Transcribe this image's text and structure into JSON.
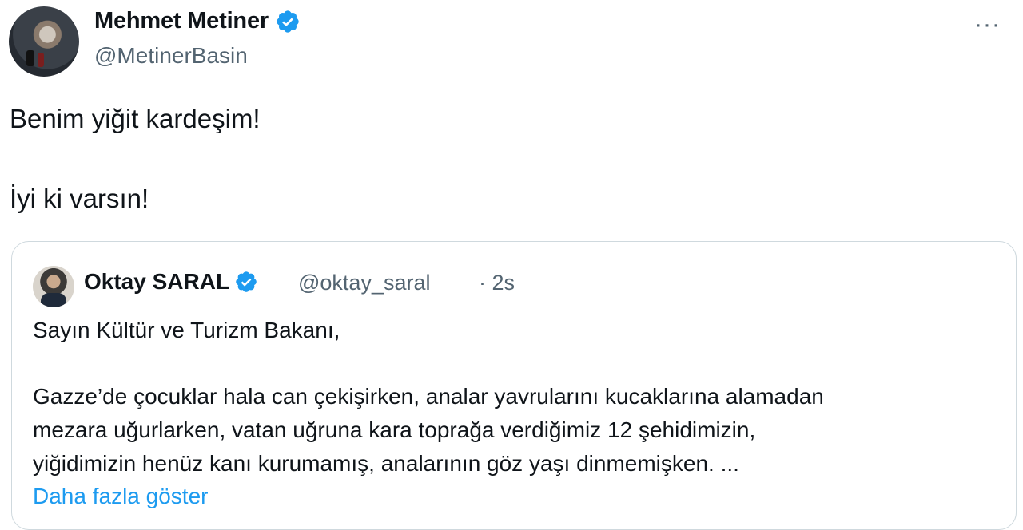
{
  "author": {
    "display_name": "Mehmet Metiner",
    "handle": "@MetinerBasin",
    "verified": true,
    "avatar_icon": "profile-photo"
  },
  "menu": {
    "more_label": "···"
  },
  "tweet": {
    "line1": "Benim yiğit kardeşim!",
    "line2": "İyi ki varsın!"
  },
  "quoted": {
    "display_name": "Oktay SARAL",
    "handle": "@oktay_saral",
    "time": "· 2s",
    "verified": true,
    "lines": [
      "Sayın Kültür ve Turizm Bakanı,",
      "Gazze’de çocuklar hala can çekişirken, analar yavrularını kucaklarına alamadan",
      "mezara uğurlarken, vatan uğruna kara toprağa verdiğimiz 12 şehidimizin,",
      "yiğidimizin henüz kanı kurumamış, analarının göz yaşı dinmemişken. ..."
    ],
    "show_more": "Daha fazla göster"
  },
  "colors": {
    "verified_badge": "#1d9bf0",
    "link": "#1d9bf0",
    "muted": "#536471",
    "border": "#cfd9de"
  }
}
